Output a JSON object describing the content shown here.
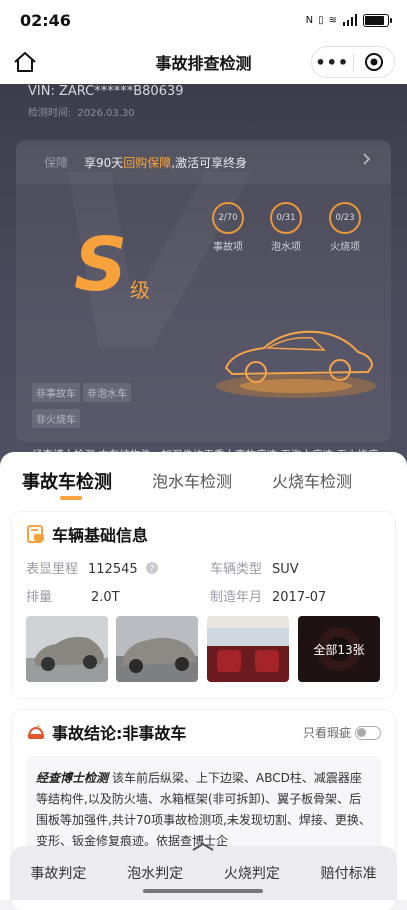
{
  "status": {
    "time": "02:46",
    "battery": 0.85
  },
  "nav": {
    "title": "事故排查检测",
    "more": "•••"
  },
  "vehicle": {
    "vin_label": "VIN:",
    "vin": "ZARC******B80639",
    "date_label": "检测时间:",
    "date": "2026.03.30"
  },
  "guarantee": {
    "label": "保障",
    "text_pre": "享90天",
    "text_hl": "回购保障",
    "text_post": ",激活可享终身"
  },
  "grade": {
    "letter": "S",
    "suffix": "级"
  },
  "stats": [
    {
      "value": "2/70",
      "label": "事故项"
    },
    {
      "value": "0/31",
      "label": "泡水项"
    },
    {
      "value": "0/23",
      "label": "火烧项"
    }
  ],
  "tags": [
    "非事故车",
    "非泡水车",
    "非火烧车"
  ],
  "conclusion": "经查博士检测,本车结构件、加强件均无重大事故痕迹;无泡水痕迹;无火烧痕迹;",
  "tabs": [
    "事故车检测",
    "泡水车检测",
    "火烧车检测"
  ],
  "basic": {
    "title": "车辆基础信息",
    "rows": [
      {
        "k1": "表显里程",
        "v1": "112545",
        "k2": "车辆类型",
        "v2": "SUV"
      },
      {
        "k1": "排量",
        "v1": "2.0T",
        "k2": "制造年月",
        "v2": "2017-07"
      }
    ],
    "all_photos": "全部13张"
  },
  "accident": {
    "title": "事故结论:非事故车",
    "toggle_label": "只看瑕疵",
    "brand": "经查博士检测",
    "text": "该车前后纵梁、上下边梁、ABCD柱、减震器座等结构件,以及防火墙、水箱框架(非可拆卸)、翼子板骨架、后围板等加强件,共计70项事故检测项,未发现切割、焊接、更换、变形、钣金修复痕迹。依据查博士企"
  },
  "bottom_nav": [
    "事故判定",
    "泡水判定",
    "火烧判定",
    "赔付标准"
  ],
  "colors": {
    "accent": "#f7a23c",
    "hero_bg": "#45455a"
  }
}
